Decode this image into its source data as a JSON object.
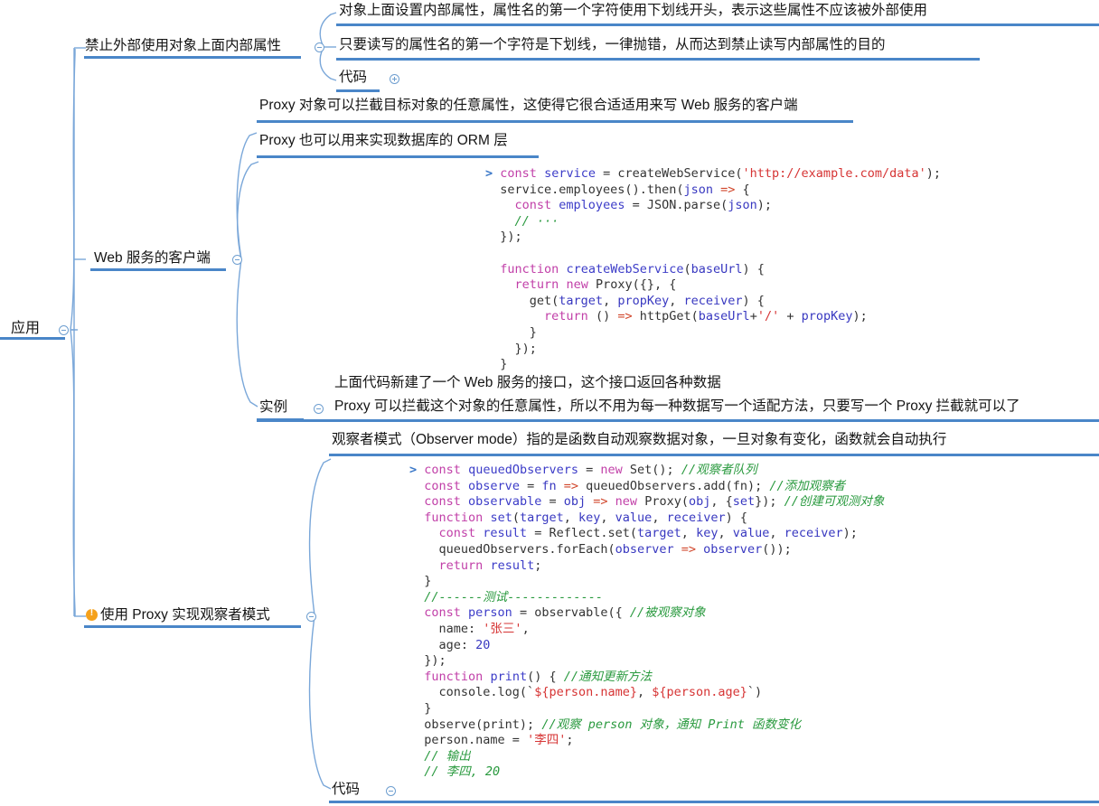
{
  "mindmap": {
    "root": {
      "label": "应用"
    },
    "branches": [
      {
        "id": "b1",
        "label": "禁止外部使用对象上面内部属性",
        "children": [
          {
            "label": "对象上面设置内部属性，属性名的第一个字符使用下划线开头，表示这些属性不应该被外部使用"
          },
          {
            "label": "只要读写的属性名的第一个字符是下划线，一律抛错，从而达到禁止读写内部属性的目的"
          },
          {
            "label": "代码",
            "state": "collapsed"
          }
        ]
      },
      {
        "id": "b2",
        "label": "Web 服务的客户端",
        "children": [
          {
            "label": "Proxy 对象可以拦截目标对象的任意属性，这使得它很合适适用来写 Web 服务的客户端"
          },
          {
            "label": "Proxy 也可以用来实现数据库的 ORM 层"
          },
          {
            "label": "实例",
            "state": "expanded"
          }
        ],
        "instance_lines": [
          "上面代码新建了一个 Web 服务的接口，这个接口返回各种数据",
          "Proxy 可以拦截这个对象的任意属性，所以不用为每一种数据写一个适配方法，只要写一个 Proxy 拦截就可以了"
        ]
      },
      {
        "id": "b3",
        "label": "使用 Proxy 实现观察者模式",
        "marker": "warning",
        "children": [
          {
            "label": "观察者模式（Observer mode）指的是函数自动观察数据对象，一旦对象有变化，函数就会自动执行"
          },
          {
            "label": "代码",
            "state": "expanded"
          }
        ]
      }
    ]
  },
  "code_blocks": {
    "web_service": [
      "const service = createWebService('http://example.com/data');",
      "service.employees().then(json => {",
      "  const employees = JSON.parse(json);",
      "  // ...",
      "});",
      "",
      "function createWebService(baseUrl) {",
      "  return new Proxy({}, {",
      "    get(target, propKey, receiver) {",
      "      return () => httpGet(baseUrl+'/' + propKey);",
      "    }",
      "  });",
      "}"
    ],
    "observer": [
      "const queuedObservers = new Set(); //观察者队列",
      "const observe = fn => queuedObservers.add(fn); //添加观察者",
      "const observable = obj => new Proxy(obj, {set}); //创建可观测对象",
      "function set(target, key, value, receiver) {",
      "  const result = Reflect.set(target, key, value, receiver);",
      "  queuedObservers.forEach(observer => observer());",
      "  return result;",
      "}",
      "//------测试-------------",
      "const person = observable({ //被观察对象",
      "  name: '张三',",
      "  age: 20",
      "});",
      "function print() { //通知更新方法",
      "  console.log(`${person.name}, ${person.age}`)",
      "}",
      "observe(print); //观察 person 对象，通知 Print 函数变化",
      "person.name = '李四';",
      "// 输出",
      "// 李四, 20"
    ]
  },
  "colors": {
    "accent_underline": "#4a86c8",
    "branch_line": "#7aa7d9",
    "warning": "#f5a11b",
    "code_keyword": "#c13fa8",
    "code_string": "#d63434",
    "code_comment": "#2a9a3f",
    "code_variable": "#3838c0"
  }
}
